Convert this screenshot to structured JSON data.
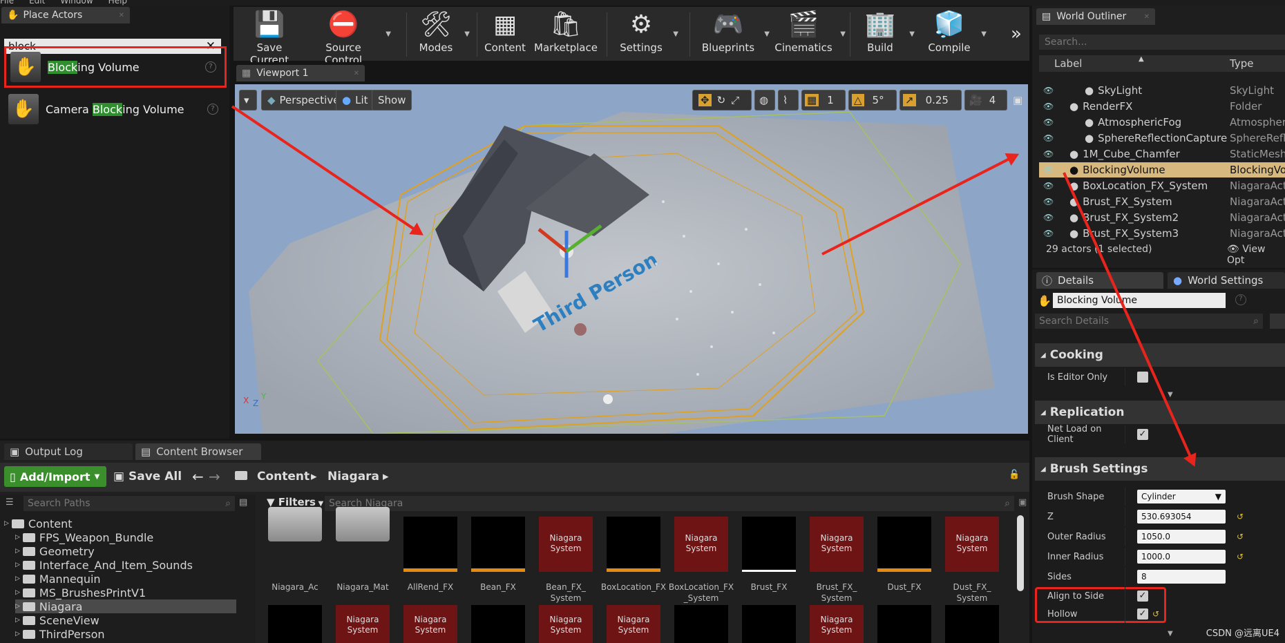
{
  "menu": [
    "File",
    "Edit",
    "Window",
    "Help"
  ],
  "place": {
    "tab": "Place Actors",
    "search": "block",
    "items": [
      {
        "pre": "",
        "hl": "Block",
        "post": "ing Volume"
      },
      {
        "pre": "Camera ",
        "hl": "Block",
        "post": "ing Volume"
      }
    ]
  },
  "toolbar": [
    "Save Current",
    "Source Control",
    "Modes",
    "Content",
    "Marketplace",
    "Settings",
    "Blueprints",
    "Cinematics",
    "Build",
    "Compile"
  ],
  "viewport": {
    "tab": "Viewport 1",
    "perspective": "Perspective",
    "lit": "Lit",
    "show": "Show",
    "grid": "1",
    "angle": "5°",
    "scale": "0.25",
    "cam": "4",
    "text3d": "Third Person"
  },
  "outliner": {
    "tab": "World Outliner",
    "search_placeholder": "Search...",
    "col_label": "Label",
    "col_type": "Type",
    "rows": [
      {
        "label": "SkyLight",
        "type": "SkyLight",
        "indent": 2
      },
      {
        "label": "RenderFX",
        "type": "Folder",
        "indent": 1
      },
      {
        "label": "AtmosphericFog",
        "type": "AtmospherFog",
        "indent": 2
      },
      {
        "label": "SphereReflectionCapture",
        "type": "SphereRefl",
        "indent": 2
      },
      {
        "label": "1M_Cube_Chamfer",
        "type": "StaticMesh",
        "indent": 1
      },
      {
        "label": "BlockingVolume",
        "type": "BlockingVo",
        "indent": 1,
        "sel": true
      },
      {
        "label": "BoxLocation_FX_System",
        "type": "NiagaraAct",
        "indent": 1
      },
      {
        "label": "Brust_FX_System",
        "type": "NiagaraAct",
        "indent": 1
      },
      {
        "label": "Brust_FX_System2",
        "type": "NiagaraAct",
        "indent": 1
      },
      {
        "label": "Brust_FX_System3",
        "type": "NiagaraAct",
        "indent": 1
      }
    ],
    "status": "29 actors (1 selected)",
    "view_options": "View Opt"
  },
  "details": {
    "tab": "Details",
    "tab2": "World Settings",
    "name": "Blocking Volume",
    "search_placeholder": "Search Details",
    "sections": {
      "cooking": "Cooking",
      "replication": "Replication",
      "brush": "Brush Settings"
    },
    "props": {
      "editor_only": "Is Editor Only",
      "net_load": "Net Load on Client",
      "brush_shape": "Brush Shape",
      "brush_shape_val": "Cylinder",
      "z": "Z",
      "z_val": "530.693054",
      "outer": "Outer Radius",
      "outer_val": "1050.0",
      "inner": "Inner Radius",
      "inner_val": "1000.0",
      "sides": "Sides",
      "sides_val": "8",
      "align": "Align to Side",
      "hollow": "Hollow"
    }
  },
  "bottom": {
    "tab1": "Output Log",
    "tab2": "Content Browser",
    "add": "Add/Import",
    "save_all": "Save All",
    "crumbs": [
      "Content",
      "Niagara"
    ],
    "paths_placeholder": "Search Paths",
    "filters": "Filters",
    "search_placeholder": "Search Niagara",
    "tree": [
      {
        "label": "Content",
        "lvl": 0
      },
      {
        "label": "FPS_Weapon_Bundle",
        "lvl": 1
      },
      {
        "label": "Geometry",
        "lvl": 1
      },
      {
        "label": "Interface_And_Item_Sounds",
        "lvl": 1
      },
      {
        "label": "Mannequin",
        "lvl": 1
      },
      {
        "label": "MS_BrushesPrintV1",
        "lvl": 1
      },
      {
        "label": "Niagara",
        "lvl": 1,
        "sel": true
      },
      {
        "label": "SceneView",
        "lvl": 1
      },
      {
        "label": "ThirdPerson",
        "lvl": 1
      }
    ],
    "assets": [
      {
        "name": "Niagara_Ac",
        "kind": "folder"
      },
      {
        "name": "Niagara_Mat",
        "kind": "folder"
      },
      {
        "name": "AllRend_FX",
        "kind": "black"
      },
      {
        "name": "Bean_FX",
        "kind": "black"
      },
      {
        "name": "Bean_FX_\nSystem",
        "kind": "red"
      },
      {
        "name": "BoxLocation_FX",
        "kind": "black"
      },
      {
        "name": "BoxLocation_FX\n_System",
        "kind": "red"
      },
      {
        "name": "Brust_FX",
        "kind": "spark"
      },
      {
        "name": "Brust_FX_\nSystem",
        "kind": "red"
      },
      {
        "name": "Dust_FX",
        "kind": "black"
      },
      {
        "name": "Dust_FX_\nSystem",
        "kind": "red"
      }
    ],
    "asset_red_label": "Niagara\nSystem",
    "row2": [
      "black",
      "red",
      "red",
      "black",
      "red",
      "red",
      "black",
      "black",
      "red",
      "black",
      "black"
    ]
  },
  "watermark": "CSDN @远离UE4"
}
